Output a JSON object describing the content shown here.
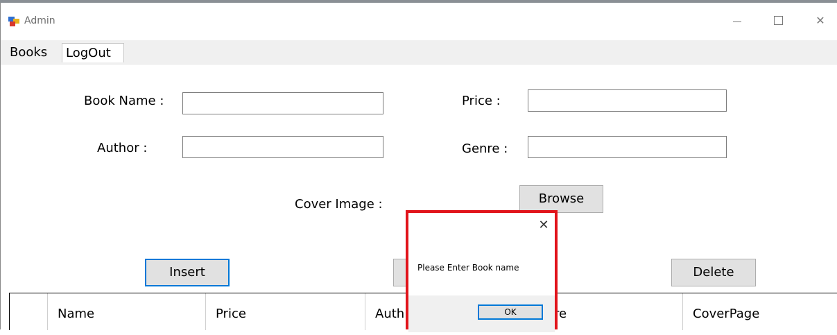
{
  "window": {
    "title": "Admin",
    "controls": {
      "minimize_icon": "minimize-icon",
      "maximize_icon": "maximize-icon",
      "close_icon": "close-icon",
      "close_glyph": "✕"
    }
  },
  "menu": {
    "tabs": [
      {
        "label": "Books"
      },
      {
        "label": "LogOut"
      }
    ]
  },
  "form": {
    "book_name_label": "Book Name :",
    "book_name_value": "",
    "price_label": "Price :",
    "price_value": "",
    "author_label": "Author :",
    "author_value": "",
    "genre_label": "Genre :",
    "genre_value": "",
    "cover_image_label": "Cover Image :",
    "browse_label": "Browse"
  },
  "actions": {
    "insert_label": "Insert",
    "delete_label": "Delete"
  },
  "grid": {
    "columns": [
      "Name",
      "Price",
      "Auth",
      "re",
      "CoverPage"
    ]
  },
  "dialog": {
    "message": "Please Enter Book name",
    "ok_label": "OK",
    "close_glyph": "✕"
  },
  "colors": {
    "accent": "#0078d7",
    "highlight_border": "#e1141b",
    "button_face": "#e1e1e1"
  }
}
